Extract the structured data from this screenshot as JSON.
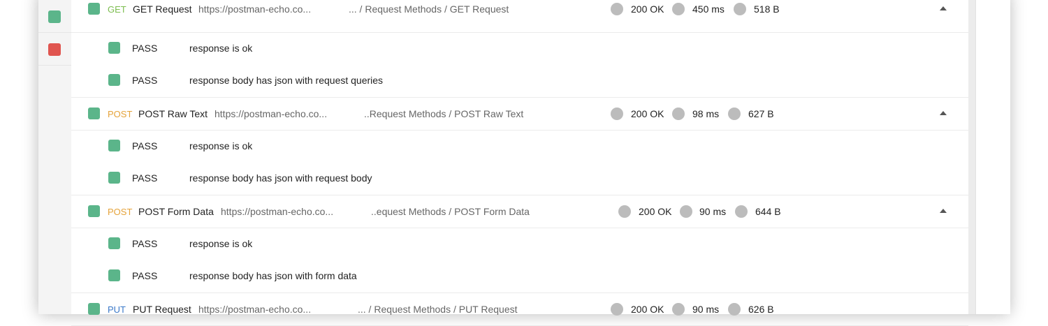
{
  "accent_color": "#e9692c",
  "pass_color": "#5bb58a",
  "fail_color": "#e0554f",
  "sidebar": {
    "items": [
      {
        "result": "fail"
      },
      {
        "result": "pass"
      },
      {
        "result": "fail"
      }
    ]
  },
  "requests": [
    {
      "method": "GET",
      "name": "GET Request",
      "url": "https://postman-echo.co...",
      "path": "... / Request Methods / GET Request",
      "status": "200 OK",
      "time": "450 ms",
      "size": "518 B",
      "tests": [
        {
          "status": "PASS",
          "description": "response is ok"
        },
        {
          "status": "PASS",
          "description": "response body has json with request queries"
        }
      ]
    },
    {
      "method": "POST",
      "name": "POST Raw Text",
      "url": "https://postman-echo.co...",
      "path": "..Request Methods / POST Raw Text",
      "status": "200 OK",
      "time": "98 ms",
      "size": "627 B",
      "tests": [
        {
          "status": "PASS",
          "description": "response is ok"
        },
        {
          "status": "PASS",
          "description": "response body has json with request body"
        }
      ]
    },
    {
      "method": "POST",
      "name": "POST Form Data",
      "url": "https://postman-echo.co...",
      "path": "..equest Methods / POST Form Data",
      "status": "200 OK",
      "time": "90 ms",
      "size": "644 B",
      "tests": [
        {
          "status": "PASS",
          "description": "response is ok"
        },
        {
          "status": "PASS",
          "description": "response body has json with form data"
        }
      ]
    },
    {
      "method": "PUT",
      "name": "PUT Request",
      "url": "https://postman-echo.co...",
      "path": "... / Request Methods / PUT Request",
      "status": "200 OK",
      "time": "90 ms",
      "size": "626 B",
      "tests": []
    }
  ]
}
